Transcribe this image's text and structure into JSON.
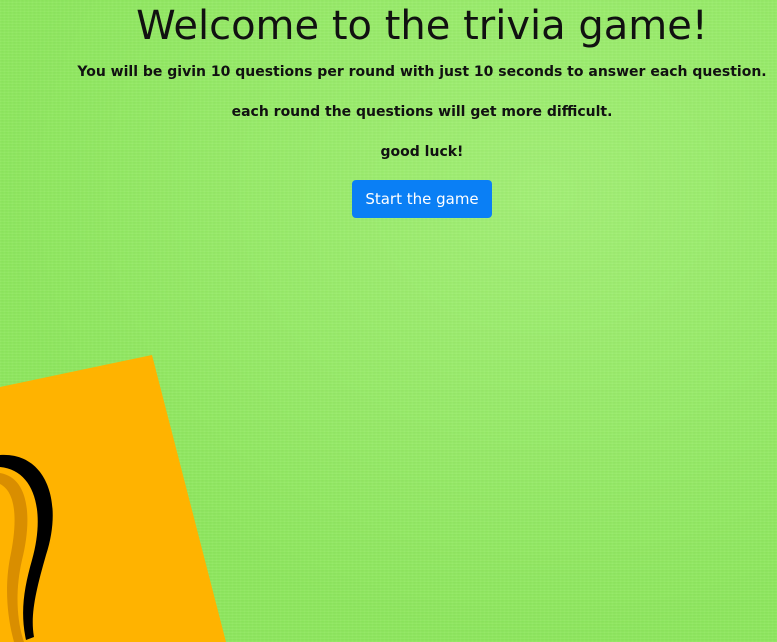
{
  "welcome": {
    "title": "Welcome to the trivia game!",
    "rules_line_1": "You will be givin 10 questions per round with just 10 seconds to answer each question.",
    "rules_line_2": "each round the questions will get more difficult.",
    "good_luck": "good luck!"
  },
  "start_button": {
    "label": "Start the game",
    "color": "#0a7ff5"
  },
  "decoration": {
    "card_color": "#ffb300",
    "card_shadow_color": "#d98e00",
    "squiggle_color": "#000000",
    "background_color": "#8ee85e"
  }
}
